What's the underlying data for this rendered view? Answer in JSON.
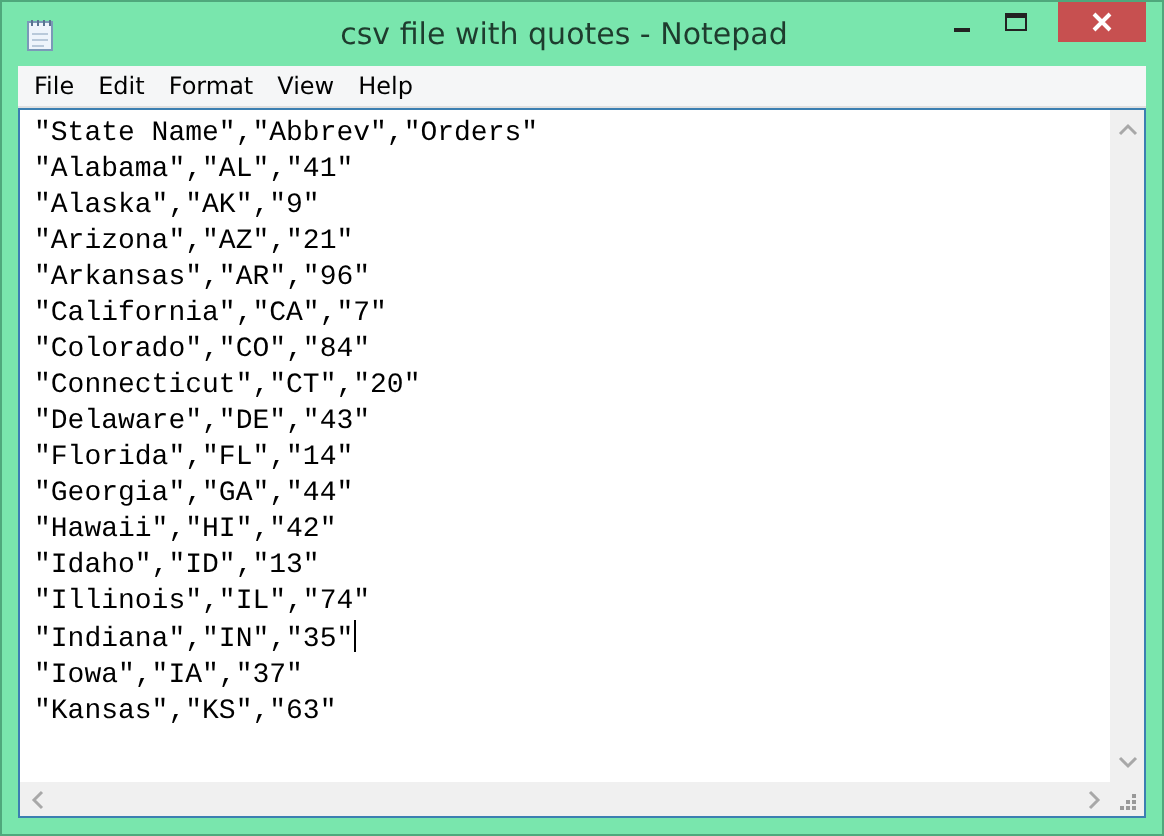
{
  "window": {
    "title": "csv file with quotes - Notepad"
  },
  "menu": [
    "File",
    "Edit",
    "Format",
    "View",
    "Help"
  ],
  "lines": [
    {
      "text": "\"State Name\",\"Abbrev\",\"Orders\"",
      "caret": false
    },
    {
      "text": "\"Alabama\",\"AL\",\"41\"",
      "caret": false
    },
    {
      "text": "\"Alaska\",\"AK\",\"9\"",
      "caret": false
    },
    {
      "text": "\"Arizona\",\"AZ\",\"21\"",
      "caret": false
    },
    {
      "text": "\"Arkansas\",\"AR\",\"96\"",
      "caret": false
    },
    {
      "text": "\"California\",\"CA\",\"7\"",
      "caret": false
    },
    {
      "text": "\"Colorado\",\"CO\",\"84\"",
      "caret": false
    },
    {
      "text": "\"Connecticut\",\"CT\",\"20\"",
      "caret": false
    },
    {
      "text": "\"Delaware\",\"DE\",\"43\"",
      "caret": false
    },
    {
      "text": "\"Florida\",\"FL\",\"14\"",
      "caret": false
    },
    {
      "text": "\"Georgia\",\"GA\",\"44\"",
      "caret": false
    },
    {
      "text": "\"Hawaii\",\"HI\",\"42\"",
      "caret": false
    },
    {
      "text": "\"Idaho\",\"ID\",\"13\"",
      "caret": false
    },
    {
      "text": "\"Illinois\",\"IL\",\"74\"",
      "caret": false
    },
    {
      "text": "\"Indiana\",\"IN\",\"35\"",
      "caret": true
    },
    {
      "text": "\"Iowa\",\"IA\",\"37\"",
      "caret": false
    },
    {
      "text": "\"Kansas\",\"KS\",\"63\"",
      "caret": false
    }
  ]
}
